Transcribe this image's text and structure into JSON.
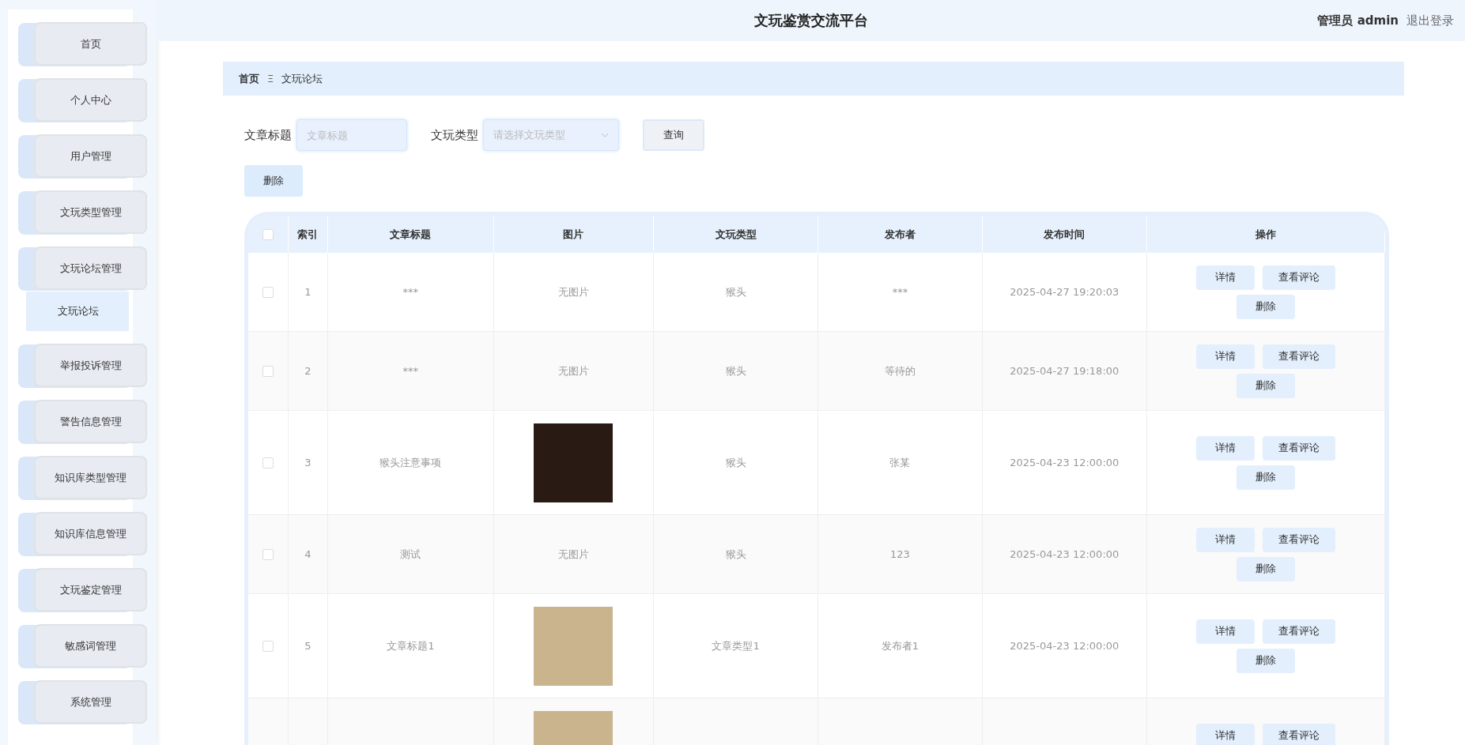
{
  "header": {
    "title": "文玩鉴赏交流平台",
    "user": "管理员 admin",
    "logout": "退出登录"
  },
  "sidebar": {
    "items": [
      {
        "label": "首页"
      },
      {
        "label": "个人中心"
      },
      {
        "label": "用户管理"
      },
      {
        "label": "文玩类型管理"
      },
      {
        "label": "文玩论坛管理",
        "children": [
          {
            "label": "文玩论坛",
            "selected": true
          }
        ]
      },
      {
        "label": "举报投诉管理"
      },
      {
        "label": "警告信息管理"
      },
      {
        "label": "知识库类型管理"
      },
      {
        "label": "知识库信息管理"
      },
      {
        "label": "文玩鉴定管理"
      },
      {
        "label": "敏感词管理"
      },
      {
        "label": "系统管理"
      }
    ]
  },
  "breadcrumb": {
    "home": "首页",
    "separator": "Ξ",
    "current": "文玩论坛"
  },
  "filters": {
    "title_label": "文章标题",
    "title_placeholder": "文章标题",
    "type_label": "文玩类型",
    "type_placeholder": "请选择文玩类型",
    "search_button": "查询"
  },
  "bulk_delete": "删除",
  "table": {
    "all_checked": false,
    "columns": [
      "索引",
      "文章标题",
      "图片",
      "文玩类型",
      "发布者",
      "发布时间",
      "操作"
    ],
    "rows": [
      {
        "checked": false,
        "index": "1",
        "title": "***",
        "picture": {
          "kind": "text",
          "text": "无图片"
        },
        "type": "猴头",
        "publisher": "***",
        "time": "2025-04-27 19:20:03",
        "actions": [
          "详情",
          "查看评论",
          "删除"
        ]
      },
      {
        "checked": false,
        "index": "2",
        "title": "***",
        "picture": {
          "kind": "text",
          "text": "无图片"
        },
        "type": "猴头",
        "publisher": "等待的",
        "time": "2025-04-27 19:18:00",
        "actions": [
          "详情",
          "查看评论",
          "删除"
        ]
      },
      {
        "checked": false,
        "index": "3",
        "title": "猴头注意事项",
        "picture": {
          "kind": "photo"
        },
        "type": "猴头",
        "publisher": "张某",
        "time": "2025-04-23 12:00:00",
        "actions": [
          "详情",
          "查看评论",
          "删除"
        ]
      },
      {
        "checked": false,
        "index": "4",
        "title": "测试",
        "picture": {
          "kind": "text",
          "text": "无图片"
        },
        "type": "猴头",
        "publisher": "123",
        "time": "2025-04-23 12:00:00",
        "actions": [
          "详情",
          "查看评论",
          "删除"
        ]
      },
      {
        "checked": false,
        "index": "5",
        "title": "文章标题1",
        "picture": {
          "kind": "photo"
        },
        "type": "文章类型1",
        "publisher": "发布者1",
        "time": "2025-04-23 12:00:00",
        "actions": [
          "详情",
          "查看评论",
          "删除"
        ]
      },
      {
        "picture": {
          "kind": "photo"
        },
        "actions": [
          "详情",
          "查看评论"
        ]
      }
    ]
  }
}
